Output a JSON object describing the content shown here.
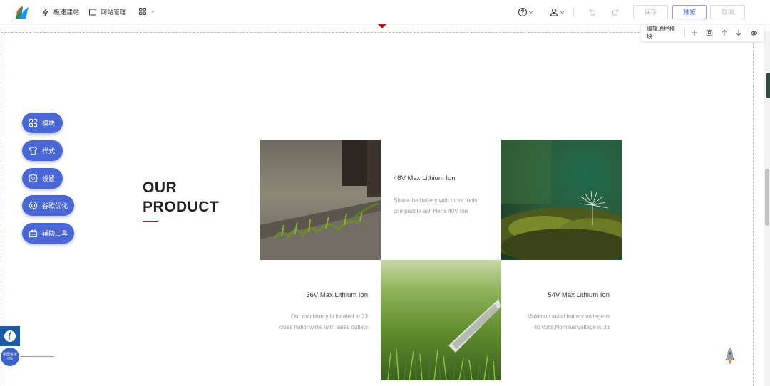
{
  "topbar": {
    "nav": [
      {
        "label": "极速建站",
        "icon": "lightning-icon"
      },
      {
        "label": "网站管理",
        "icon": "window-icon"
      }
    ],
    "save_label": "保存",
    "preview_label": "预览",
    "cancel_label": "取消"
  },
  "module_toolbar": {
    "label": "编辑通栏模块"
  },
  "side_menu": [
    {
      "label": "模块",
      "icon": "grid-icon"
    },
    {
      "label": "样式",
      "icon": "shirt-icon"
    },
    {
      "label": "设置",
      "icon": "gear-icon"
    },
    {
      "label": "谷歌优化",
      "icon": "chrome-icon"
    },
    {
      "label": "辅助工具",
      "icon": "toolbox-icon"
    }
  ],
  "section": {
    "title_line1": "OUR",
    "title_line2": "PRODUCT",
    "accent_color": "#c8181e"
  },
  "products": [
    {
      "title": "48V Max Lithium Ion",
      "desc_line1": "Share the battery with more tools,",
      "desc_line2": "compatible anll Henx 40V too"
    },
    {
      "title": "36V Max Lithium Ion",
      "desc_line1": "Our machinery is located in 33",
      "desc_line2": "cities nationwide, with sales outlets"
    },
    {
      "title": "54V Max Lithium Ion",
      "desc_line1": "Maximun initial battery voltage is",
      "desc_line2": "40 volts,Nominal voltage is 36"
    }
  ],
  "progress": {
    "label": "模型进度",
    "value": "0%"
  },
  "colors": {
    "brand_blue": "#4a67d6",
    "preview_blue": "#3b5bdb"
  }
}
